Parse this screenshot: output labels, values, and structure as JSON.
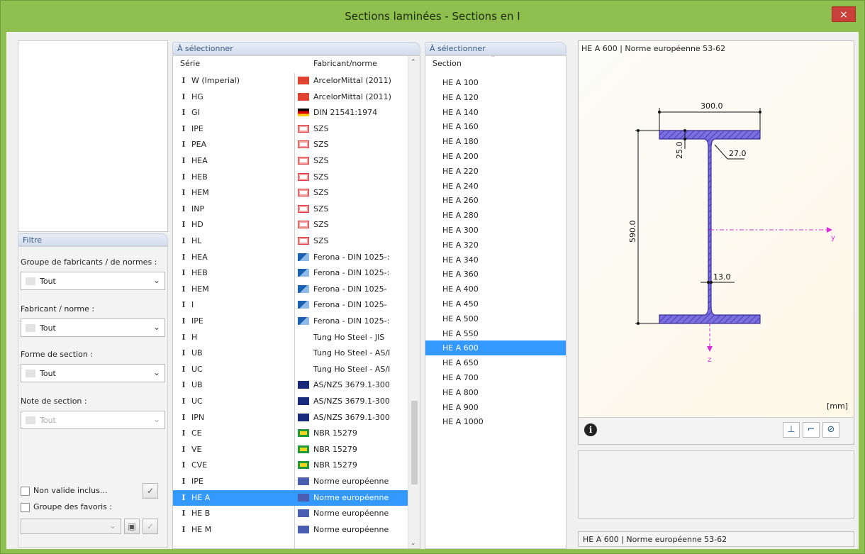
{
  "window": {
    "title": "Sections laminées - Sections en I",
    "close_glyph": "×"
  },
  "series_panel": {
    "header": "À sélectionner",
    "col_serie": "Série",
    "col_fabricant": "Fabricant/norme",
    "rows": [
      {
        "serie": "W (Imperial)",
        "fab": "ArcelorMittal (2011)",
        "flag": "arcelor"
      },
      {
        "serie": "HG",
        "fab": "ArcelorMittal (2011)",
        "flag": "arcelor"
      },
      {
        "serie": "GI",
        "fab": "DIN 21541:1974",
        "flag": "de"
      },
      {
        "serie": "IPE",
        "fab": "SZS",
        "flag": "szs"
      },
      {
        "serie": "PEA",
        "fab": "SZS",
        "flag": "szs"
      },
      {
        "serie": "HEA",
        "fab": "SZS",
        "flag": "szs"
      },
      {
        "serie": "HEB",
        "fab": "SZS",
        "flag": "szs"
      },
      {
        "serie": "HEM",
        "fab": "SZS",
        "flag": "szs"
      },
      {
        "serie": "INP",
        "fab": "SZS",
        "flag": "szs"
      },
      {
        "serie": "HD",
        "fab": "SZS",
        "flag": "szs"
      },
      {
        "serie": "HL",
        "fab": "SZS",
        "flag": "szs"
      },
      {
        "serie": "HEA",
        "fab": "Ferona - DIN 1025-:",
        "flag": "ferona"
      },
      {
        "serie": "HEB",
        "fab": "Ferona - DIN 1025-:",
        "flag": "ferona"
      },
      {
        "serie": "HEM",
        "fab": "Ferona - DIN 1025-",
        "flag": "ferona"
      },
      {
        "serie": "I",
        "fab": "Ferona - DIN 1025-",
        "flag": "ferona"
      },
      {
        "serie": "IPE",
        "fab": "Ferona - DIN 1025-:",
        "flag": "ferona"
      },
      {
        "serie": "H",
        "fab": "Tung Ho Steel - JIS",
        "flag": "tungho"
      },
      {
        "serie": "UB",
        "fab": "Tung Ho Steel - AS/I",
        "flag": "tungho"
      },
      {
        "serie": "UC",
        "fab": "Tung Ho Steel - AS/I",
        "flag": "tungho"
      },
      {
        "serie": "UB",
        "fab": "AS/NZS 3679.1-300",
        "flag": "au"
      },
      {
        "serie": "UC",
        "fab": "AS/NZS 3679.1-300",
        "flag": "au"
      },
      {
        "serie": "IPN",
        "fab": "AS/NZS 3679.1-300",
        "flag": "au"
      },
      {
        "serie": "CE",
        "fab": "NBR 15279",
        "flag": "br"
      },
      {
        "serie": "VE",
        "fab": "NBR 15279",
        "flag": "br"
      },
      {
        "serie": "CVE",
        "fab": "NBR 15279",
        "flag": "br"
      },
      {
        "serie": "IPE",
        "fab": "Norme européenne",
        "flag": "eu"
      },
      {
        "serie": "HE A",
        "fab": "Norme européenne",
        "flag": "eu"
      },
      {
        "serie": "HE B",
        "fab": "Norme européenne",
        "flag": "eu"
      },
      {
        "serie": "HE M",
        "fab": "Norme européenne",
        "flag": "eu"
      }
    ],
    "selected_index": 26
  },
  "section_panel": {
    "header": "À sélectionner",
    "col_section": "Section",
    "rows": [
      "HE A 100",
      "HE A 120",
      "HE A 140",
      "HE A 160",
      "HE A 180",
      "HE A 200",
      "HE A 220",
      "HE A 240",
      "HE A 260",
      "HE A 280",
      "HE A 300",
      "HE A 320",
      "HE A 340",
      "HE A 360",
      "HE A 400",
      "HE A 450",
      "HE A 500",
      "HE A 550",
      "HE A 600",
      "HE A 650",
      "HE A 700",
      "HE A 800",
      "HE A 900",
      "HE A 1000"
    ],
    "selected_index": 18
  },
  "filter": {
    "header": "Filtre",
    "group_label": "Groupe de fabricants / de normes :",
    "group_value": "Tout",
    "maker_label": "Fabricant / norme :",
    "maker_value": "Tout",
    "shape_label": "Forme de section :",
    "shape_value": "Tout",
    "note_label": "Note de section :",
    "note_value": "Tout",
    "invalid_label": "Non valide inclus...",
    "favorites_label": "Groupe des favoris :"
  },
  "preview": {
    "title": "HE A 600 | Norme européenne 53-62",
    "dim_width": "300.0",
    "dim_flange": "25.0",
    "dim_radius": "27.0",
    "dim_height": "590.0",
    "dim_web": "13.0",
    "axis_y": "y",
    "axis_z": "z",
    "unit": "[mm]",
    "info_icon": "i",
    "status": "HE A 600 | Norme européenne 53-62"
  },
  "colors": {
    "selection": "#3399ff",
    "section_fill": "#6a5acd",
    "axis": "#d62bd6"
  }
}
